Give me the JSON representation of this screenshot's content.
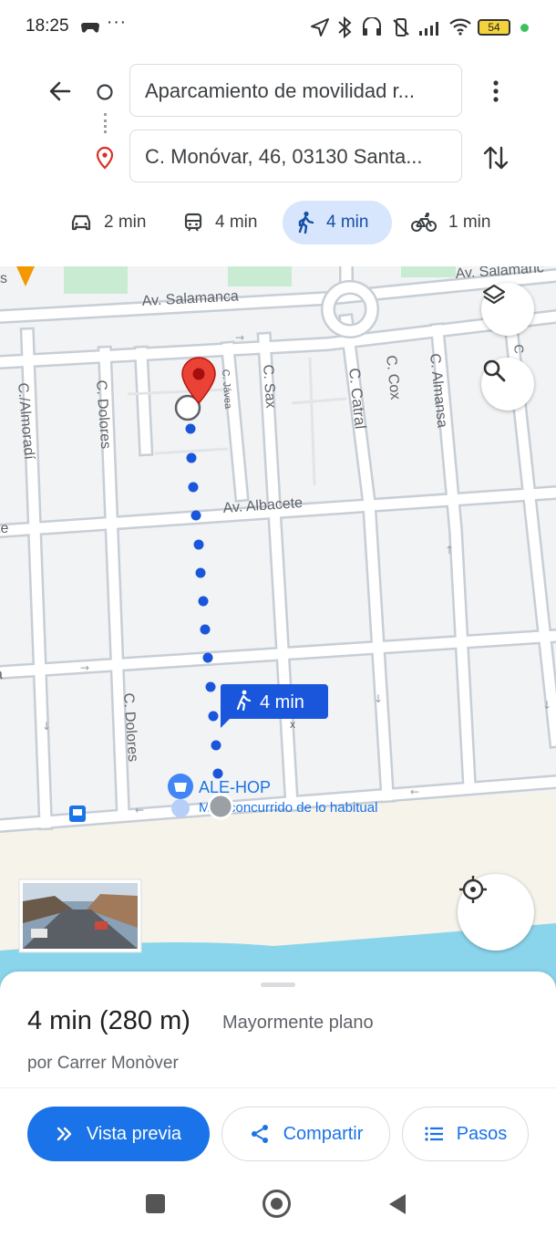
{
  "status_bar": {
    "time": "18:25",
    "dots": "···",
    "battery": "54"
  },
  "route": {
    "origin": "Aparcamiento de movilidad r...",
    "destination": "C. Monóvar, 46, 03130 Santa..."
  },
  "modes": [
    {
      "id": "drive",
      "icon": "car-icon",
      "label": "2 min",
      "active": false
    },
    {
      "id": "transit",
      "icon": "train-icon",
      "label": "4 min",
      "active": false
    },
    {
      "id": "walk",
      "icon": "walk-icon",
      "label": "4 min",
      "active": true
    },
    {
      "id": "bike",
      "icon": "bike-icon",
      "label": "1 min",
      "active": false
    }
  ],
  "map": {
    "streets": {
      "salamanca_main": "Av. Salamanca",
      "salamanca_right": "Av. Salamanc",
      "albacete": "Av. Albacete",
      "almoradi": "C./Almoradí",
      "dolores_top": "C. Dolores",
      "dolores_bottom": "C. Dolores",
      "javea": "C. Jávea",
      "sax": "C. Sax",
      "catral": "C. Catral",
      "cox": "C. Cox",
      "almansa": "C. Almansa",
      "edge_left_te": "te",
      "edge_left_a": "a",
      "edge_top_s": "s",
      "edge_x": "x",
      "edge_c": "C"
    },
    "route_badge": "4 min",
    "poi_name": "ALE-HOP",
    "poi_sub": "M",
    "poi_status": "concurrido de lo habitual"
  },
  "sheet": {
    "summary_time": "4 min (280 m)",
    "summary_terrain": "Mayormente plano",
    "via": "por Carrer Monòver",
    "buttons": {
      "preview": "Vista previa",
      "share": "Compartir",
      "steps": "Pasos"
    }
  },
  "colors": {
    "accent": "#1a73e8",
    "route_dot": "#1a56db",
    "active_mode_bg": "#d7e6fd",
    "destination_pin": "#d93025",
    "water": "#8ad5ec",
    "sand": "#f6f3ea"
  }
}
